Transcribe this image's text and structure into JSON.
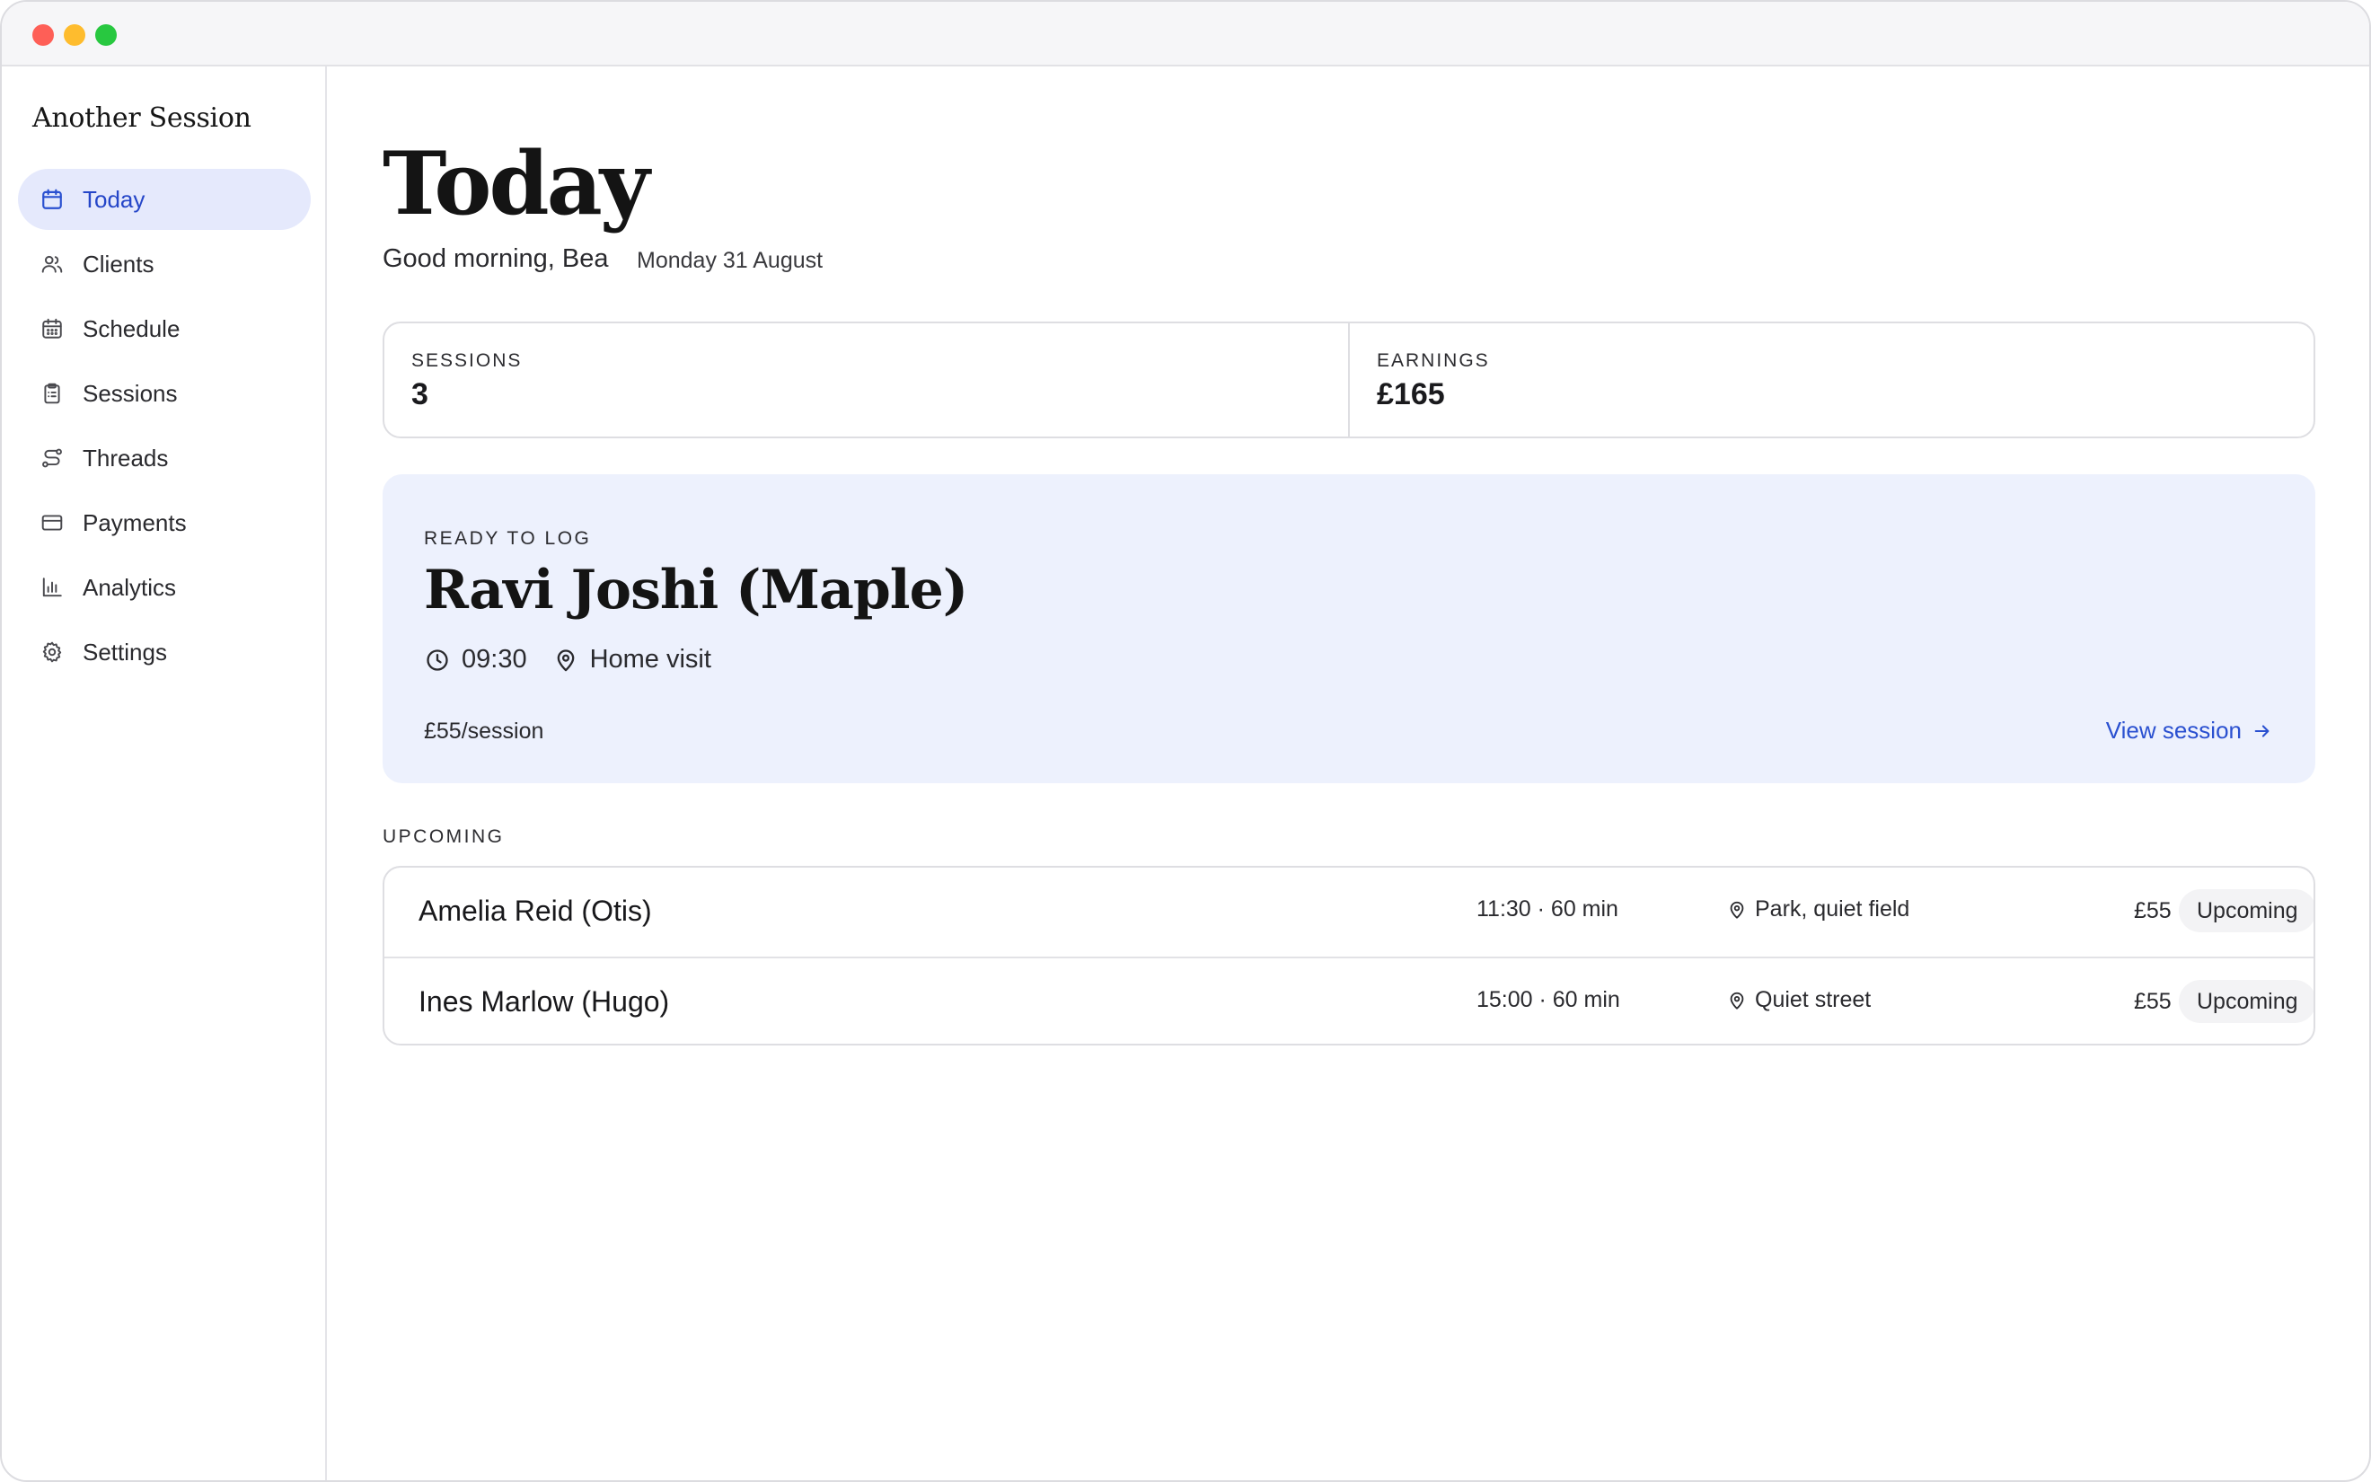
{
  "app": {
    "brand": "Another Session"
  },
  "sidebar": {
    "items": [
      {
        "label": "Today",
        "icon": "calendar-icon",
        "active": true
      },
      {
        "label": "Clients",
        "icon": "users-icon"
      },
      {
        "label": "Schedule",
        "icon": "calendar-grid-icon"
      },
      {
        "label": "Sessions",
        "icon": "clipboard-icon"
      },
      {
        "label": "Threads",
        "icon": "route-icon"
      },
      {
        "label": "Payments",
        "icon": "credit-card-icon"
      },
      {
        "label": "Analytics",
        "icon": "bar-chart-icon"
      },
      {
        "label": "Settings",
        "icon": "gear-icon"
      }
    ]
  },
  "header": {
    "title": "Today",
    "greeting": "Good morning, Bea",
    "date": "Monday 31 August"
  },
  "stats": {
    "sessions_label": "SESSIONS",
    "sessions_value": "3",
    "earnings_label": "EARNINGS",
    "earnings_value": "£165"
  },
  "ready": {
    "label": "READY TO LOG",
    "name": "Ravi Joshi (Maple)",
    "time": "09:30",
    "location": "Home visit",
    "price": "£55/session",
    "link": "View session"
  },
  "upcoming": {
    "label": "UPCOMING",
    "rows": [
      {
        "name": "Amelia Reid (Otis)",
        "time": "11:30 · 60 min",
        "location": "Park, quiet field",
        "price": "£55",
        "status": "Upcoming"
      },
      {
        "name": "Ines Marlow (Hugo)",
        "time": "15:00 · 60 min",
        "location": "Quiet street",
        "price": "£55",
        "status": "Upcoming"
      }
    ]
  },
  "colors": {
    "accent": "#2a50d0",
    "active_bg": "#e5e9fc",
    "ready_bg": "#edf1fd"
  }
}
